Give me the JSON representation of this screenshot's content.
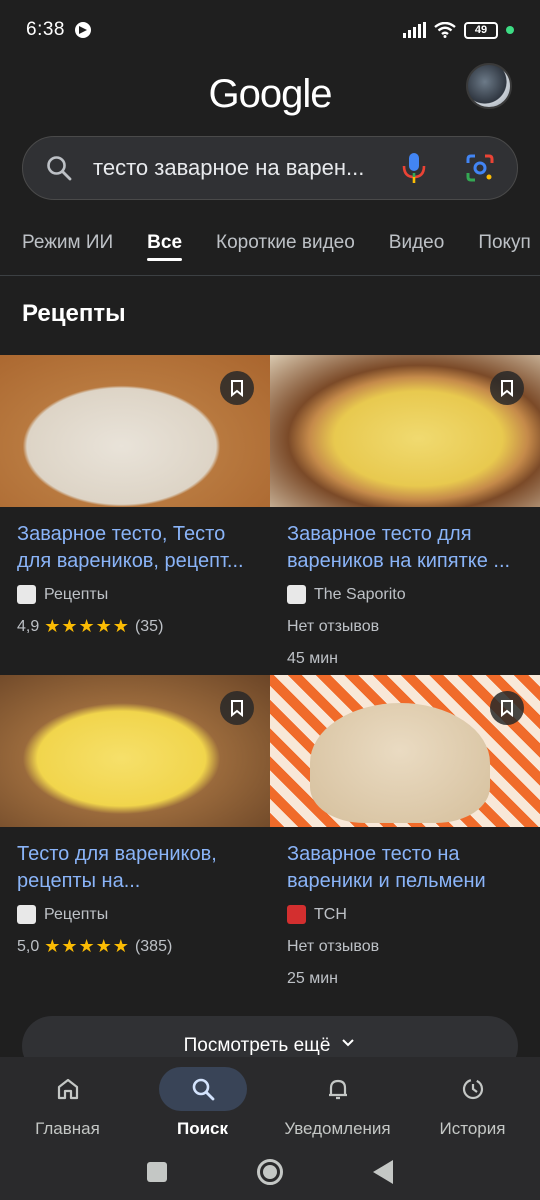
{
  "status_bar": {
    "time": "6:38",
    "battery": "49"
  },
  "header": {
    "logo": "Google"
  },
  "search": {
    "query": "тесто заварное на варен..."
  },
  "tabs": [
    {
      "label": "Режим ИИ"
    },
    {
      "label": "Все"
    },
    {
      "label": "Короткие видео"
    },
    {
      "label": "Видео"
    },
    {
      "label": "Покуп"
    }
  ],
  "section": {
    "title": "Рецепты"
  },
  "recipes": [
    {
      "title": "Заварное тесто, Тесто для вареников, рецепт...",
      "source": "Рецепты",
      "rating": "4,9",
      "stars": "★★★★★",
      "reviews": "(35)"
    },
    {
      "title": "Заварное тесто для вареников на кипятке ...",
      "source": "The Saporito",
      "no_reviews": "Нет отзывов",
      "time": "45 мин"
    },
    {
      "title": "Тесто для вареников, рецепты на...",
      "source": "Рецепты",
      "rating": "5,0",
      "stars": "★★★★★",
      "reviews": "(385)"
    },
    {
      "title": "Заварное тесто на вареники и пельмени",
      "source": "ТСН",
      "no_reviews": "Нет отзывов",
      "time": "25 мин"
    }
  ],
  "see_more": {
    "label": "Посмотреть ещё"
  },
  "bottom_nav": [
    {
      "label": "Главная",
      "icon": "home-icon"
    },
    {
      "label": "Поиск",
      "icon": "search-icon"
    },
    {
      "label": "Уведомления",
      "icon": "bell-icon"
    },
    {
      "label": "История",
      "icon": "history-icon"
    }
  ],
  "colors": {
    "link": "#8ab4f8",
    "star": "#fbbc04",
    "background": "#1f1f1f"
  }
}
